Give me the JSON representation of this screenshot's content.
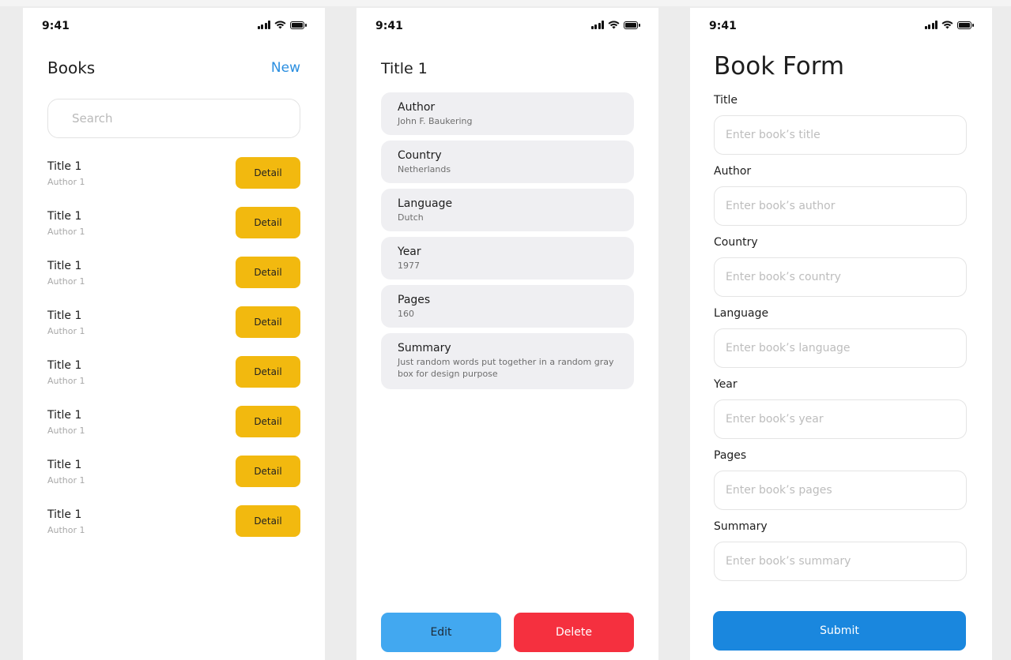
{
  "status": {
    "time": "9:41"
  },
  "books_screen": {
    "title": "Books",
    "new_label": "New",
    "search_placeholder": "Search",
    "detail_label": "Detail",
    "items": [
      {
        "title": "Title 1",
        "author": "Author 1"
      },
      {
        "title": "Title 1",
        "author": "Author 1"
      },
      {
        "title": "Title 1",
        "author": "Author 1"
      },
      {
        "title": "Title 1",
        "author": "Author 1"
      },
      {
        "title": "Title 1",
        "author": "Author 1"
      },
      {
        "title": "Title 1",
        "author": "Author 1"
      },
      {
        "title": "Title 1",
        "author": "Author 1"
      },
      {
        "title": "Title 1",
        "author": "Author 1"
      }
    ]
  },
  "detail_screen": {
    "title": "Title 1",
    "fields": [
      {
        "label": "Author",
        "value": "John F. Baukering"
      },
      {
        "label": "Country",
        "value": "Netherlands"
      },
      {
        "label": "Language",
        "value": "Dutch"
      },
      {
        "label": "Year",
        "value": "1977"
      },
      {
        "label": "Pages",
        "value": "160"
      },
      {
        "label": "Summary",
        "value": "Just random words put together in a random gray box for design purpose"
      }
    ],
    "edit_label": "Edit",
    "delete_label": "Delete"
  },
  "form_screen": {
    "title": "Book Form",
    "fields": [
      {
        "label": "Title",
        "placeholder": "Enter book’s title"
      },
      {
        "label": "Author",
        "placeholder": "Enter book’s author"
      },
      {
        "label": "Country",
        "placeholder": "Enter book’s country"
      },
      {
        "label": "Language",
        "placeholder": "Enter book’s language"
      },
      {
        "label": "Year",
        "placeholder": "Enter book’s year"
      },
      {
        "label": "Pages",
        "placeholder": "Enter book’s pages"
      },
      {
        "label": "Summary",
        "placeholder": "Enter book’s summary"
      }
    ],
    "submit_label": "Submit"
  },
  "colors": {
    "accent_link": "#2a8ee0",
    "detail_button": "#f2b90f",
    "edit_button": "#42a8f0",
    "delete_button": "#f5303f",
    "submit_button": "#1a87de",
    "card_background": "#efeff2"
  },
  "icons": [
    "signal-icon",
    "wifi-icon",
    "battery-icon"
  ]
}
